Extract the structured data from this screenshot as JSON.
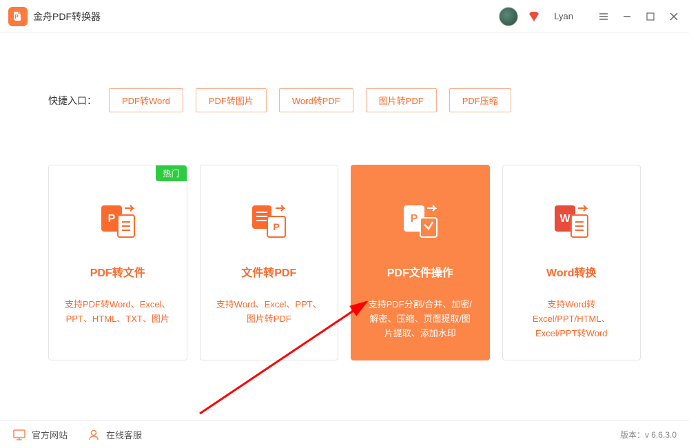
{
  "app": {
    "name": "金舟PDF转换器"
  },
  "user": {
    "name": "Lyan"
  },
  "quickEntry": {
    "label": "快捷入口：",
    "buttons": [
      "PDF转Word",
      "PDF转图片",
      "Word转PDF",
      "图片转PDF",
      "PDF压缩"
    ]
  },
  "cards": [
    {
      "badge": "热门",
      "title": "PDF转文件",
      "desc": "支持PDF转Word、Excel、PPT、HTML、TXT、图片"
    },
    {
      "title": "文件转PDF",
      "desc": "支持Word、Excel、PPT、图片转PDF"
    },
    {
      "title": "PDF文件操作",
      "desc": "支持PDF分割/合并、加密/解密、压缩、页面提取/图片提取、添加水印",
      "active": true
    },
    {
      "title": "Word转换",
      "desc": "支持Word转Excel/PPT/HTML、Excel/PPT转Word"
    }
  ],
  "footer": {
    "website": "官方网站",
    "support": "在线客服",
    "versionLabel": "版本：",
    "version": "v 6.6.3.0"
  }
}
